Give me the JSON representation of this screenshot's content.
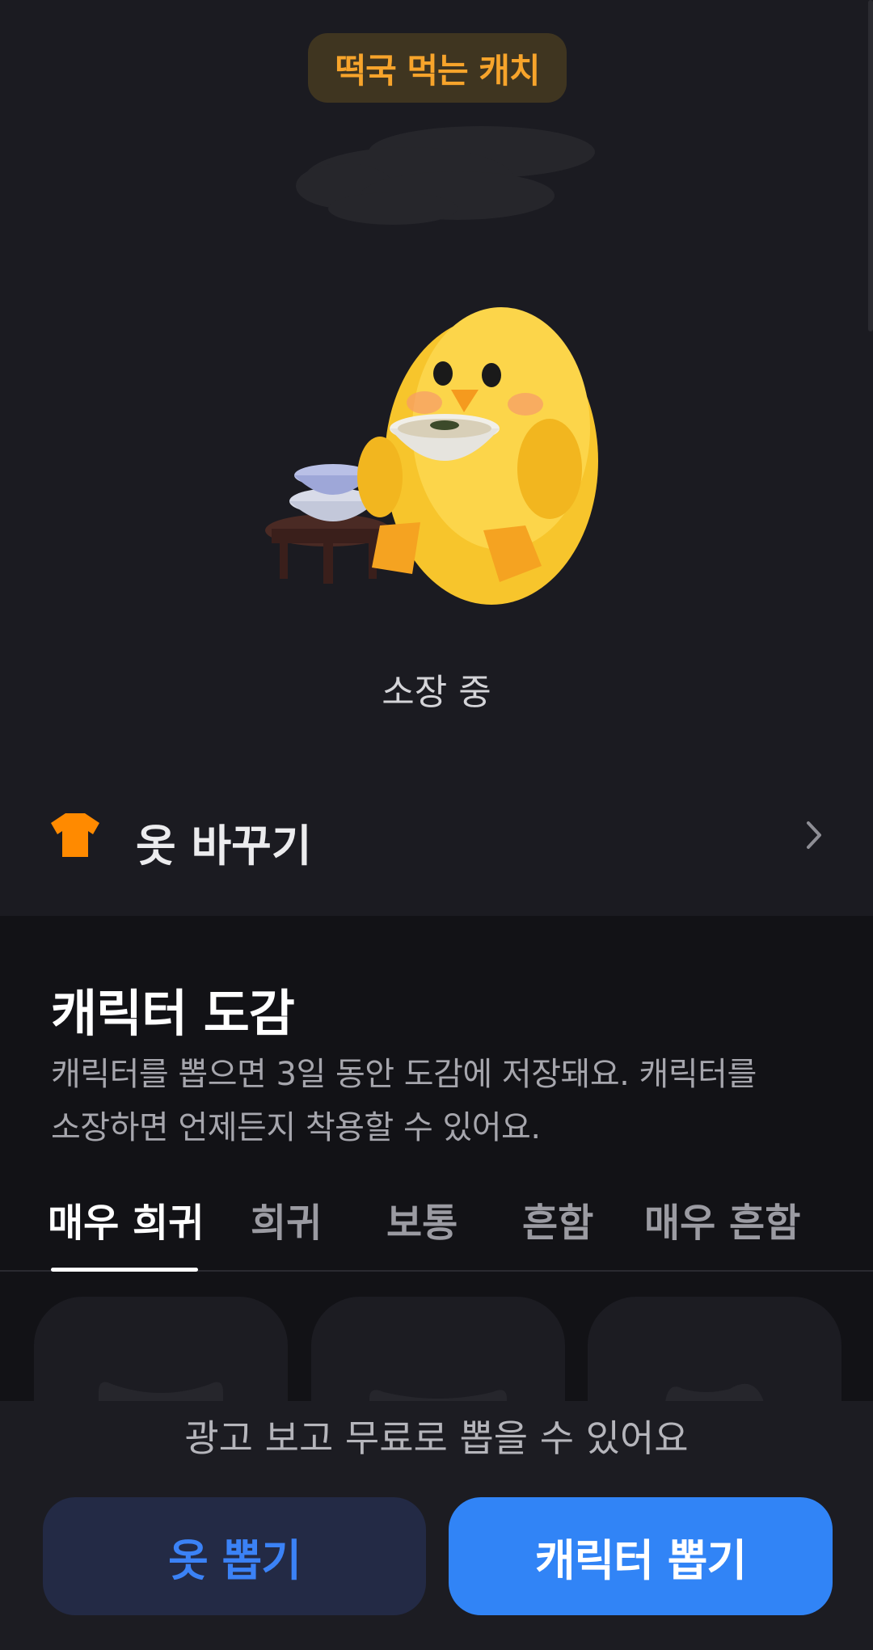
{
  "character": {
    "badge": "떡국 먹는 캐치",
    "status": "소장 중"
  },
  "change_clothes": {
    "label": "옷 바꾸기"
  },
  "collection": {
    "title": "캐릭터 도감",
    "description_line1": "캐릭터를 뽑으면 3일 동안 도감에 저장돼요. 캐릭터를",
    "description_line2": "소장하면 언제든지 착용할 수 있어요.",
    "tabs": [
      {
        "label": "매우 희귀",
        "active": true
      },
      {
        "label": "희귀",
        "active": false
      },
      {
        "label": "보통",
        "active": false
      },
      {
        "label": "흔함",
        "active": false
      },
      {
        "label": "매우 흔함",
        "active": false
      }
    ]
  },
  "bottom": {
    "ad_notice": "광고 보고 무료로 뽑을 수 있어요",
    "clothes_button": "옷 뽑기",
    "character_button": "캐릭터 뽑기"
  },
  "colors": {
    "accent_blue": "#3184f6",
    "badge_orange": "#f7a42b",
    "icon_orange": "#ff8a00"
  }
}
